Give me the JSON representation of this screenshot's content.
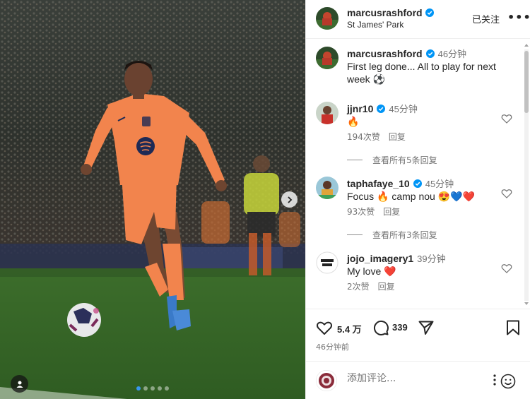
{
  "post": {
    "author": "marcusrashford",
    "location": "St James' Park",
    "follow_label": "已关注",
    "more_label": "•••",
    "verified": true
  },
  "media": {
    "dots_count": 5,
    "active_dot": 0
  },
  "caption": {
    "user": "marcusrashford",
    "time": "46分钟",
    "text": "First leg done... All to play for next week ⚽"
  },
  "comments": [
    {
      "user": "jjnr10",
      "time": "45分钟",
      "text": "🔥",
      "likes": "194次赞",
      "reply_label": "回复",
      "view_replies": "查看所有5条回复",
      "verified": true
    },
    {
      "user": "taphafaye_10",
      "time": "45分钟",
      "text": "Focus 🔥 camp nou 😍💙❤️",
      "likes": "93次赞",
      "reply_label": "回复",
      "view_replies": "查看所有3条回复",
      "verified": true
    },
    {
      "user": "jojo_imagery1",
      "time": "39分钟",
      "text": "My love ❤️",
      "likes": "2次赞",
      "reply_label": "回复",
      "verified": false
    }
  ],
  "actions": {
    "likes_count": "5.4 万",
    "comments_count": "339",
    "posted_ago": "46分钟前"
  },
  "add_comment": {
    "placeholder": "添加评论..."
  },
  "colors": {
    "verified_blue": "#0095f6",
    "jersey_orange": "#f2844d",
    "active_dot": "#3897f0"
  }
}
